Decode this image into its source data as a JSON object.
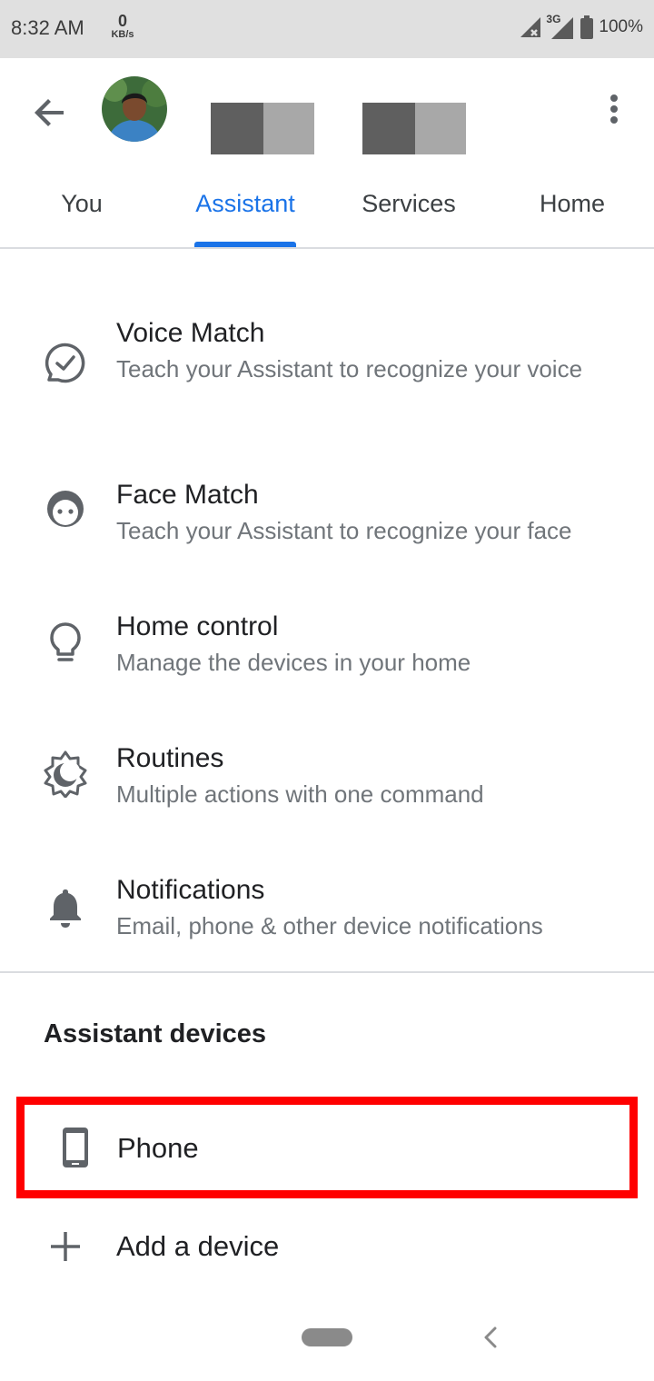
{
  "status_bar": {
    "time": "8:32 AM",
    "speed_value": "0",
    "speed_unit": "KB/s",
    "network": "3G",
    "battery": "100%"
  },
  "header": {
    "tabs": [
      {
        "label": "You",
        "active": false
      },
      {
        "label": "Assistant",
        "active": true
      },
      {
        "label": "Services",
        "active": false
      },
      {
        "label": "Home",
        "active": false
      }
    ]
  },
  "settings": [
    {
      "title": "Voice Match",
      "subtitle": "Teach your Assistant to recognize your voice",
      "icon": "voice-match-icon"
    },
    {
      "title": "Face Match",
      "subtitle": "Teach your Assistant to recognize your face",
      "icon": "face-icon"
    },
    {
      "title": "Home control",
      "subtitle": "Manage the devices in your home",
      "icon": "lightbulb-icon"
    },
    {
      "title": "Routines",
      "subtitle": "Multiple actions with one command",
      "icon": "routines-icon"
    },
    {
      "title": "Notifications",
      "subtitle": "Email, phone & other device notifications",
      "icon": "bell-icon"
    }
  ],
  "devices_section": {
    "title": "Assistant devices",
    "devices": [
      {
        "label": "Phone",
        "icon": "phone-icon",
        "highlight_color": "#ff0000"
      }
    ],
    "add_label": "Add a device"
  },
  "colors": {
    "accent": "#1a73e8",
    "highlight": "#ff0000"
  }
}
